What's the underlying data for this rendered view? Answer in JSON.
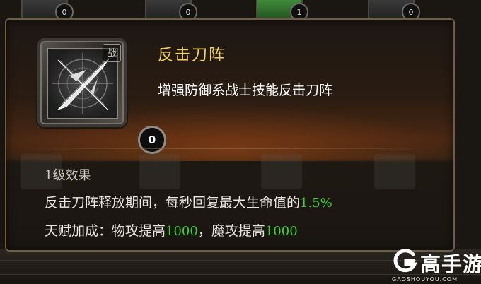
{
  "background": {
    "slot_counts": [
      "0",
      "0",
      "1",
      "0"
    ]
  },
  "tooltip": {
    "icon_tag": "战",
    "level_badge": "0",
    "skill_name": "反击刀阵",
    "skill_description": "增强防御系战士技能反击刀阵",
    "effect_title": "1级效果",
    "effect_line1_prefix": "反击刀阵释放期间，每秒回复最大生命值的",
    "effect_line1_value": "1.5%",
    "effect_line2_a": "天赋加成：物攻提高",
    "effect_line2_b": "1000",
    "effect_line2_c": "，魔攻提高",
    "effect_line2_d": "1000"
  },
  "watermark": {
    "brand": "高手游",
    "url": "GAOSHOUYOU.COM"
  },
  "colors": {
    "title": "#f2d25a",
    "highlight": "#36d12f",
    "frame": "#6e5e44"
  },
  "icons": [
    "crossed-swords-icon",
    "game-slot-icon"
  ]
}
